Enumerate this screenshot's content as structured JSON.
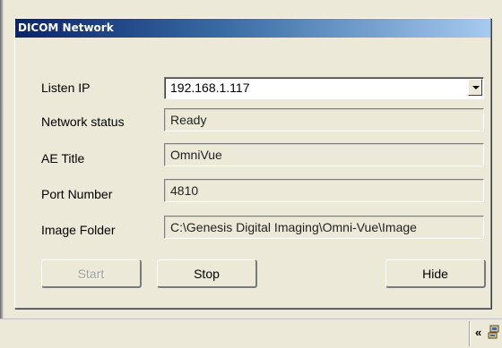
{
  "window": {
    "title": "DICOM Network"
  },
  "form": {
    "listen_ip": {
      "label": "Listen IP",
      "value": "192.168.1.117"
    },
    "network_status": {
      "label": "Network status",
      "value": "Ready"
    },
    "ae_title": {
      "label": "AE Title",
      "value": "OmniVue"
    },
    "port_number": {
      "label": "Port Number",
      "value": "4810"
    },
    "image_folder": {
      "label": "Image Folder",
      "value": "C:\\Genesis Digital Imaging\\Omni-Vue\\Image"
    }
  },
  "buttons": {
    "start": "Start",
    "stop": "Stop",
    "hide": "Hide"
  },
  "taskbar": {
    "chevron": "«",
    "tray_icon": "network-tray-icon"
  }
}
